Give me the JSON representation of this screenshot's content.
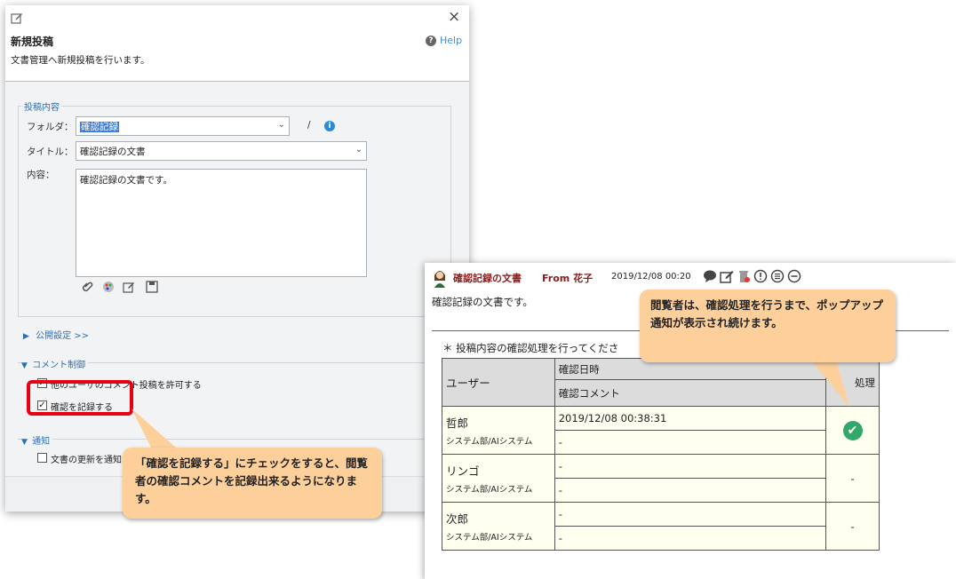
{
  "dialog": {
    "title": "新規投稿",
    "help_label": "Help",
    "description": "文書管理へ新規投稿を行います。",
    "close_glyph": "×",
    "post_section": {
      "legend": "投稿内容",
      "folder_label": "フォルダ：",
      "folder_value": "確認記録",
      "folder_separator": "/",
      "title_label": "タイトル：",
      "title_value": "確認記録の文書",
      "content_label": "内容：",
      "content_value": "確認記録の文書です。",
      "toolbar_icons": [
        "paperclip-icon",
        "palette-icon",
        "edit-icon",
        "save-icon"
      ]
    },
    "publish_section": {
      "label": "公開設定 >>"
    },
    "comment_section": {
      "legend": "コメント制御",
      "allow_comments_label": "他のユーザのコメント投稿を許可する",
      "allow_comments_checked": true,
      "record_confirm_label": "確認を記録する",
      "record_confirm_checked": true
    },
    "notify_section": {
      "legend": "通知",
      "notify_label": "文書の更新を通知す",
      "notify_checked": false
    }
  },
  "callouts": {
    "left_text": "「確認を記録する」にチェックをすると、閲覧者の確認コメントを記録出来るようになります。",
    "right_text": "閲覧者は、確認処理を行うまで、ポップアップ通知が表示され続けます。"
  },
  "panel": {
    "title": "確認記録の文書",
    "from": "From 花子",
    "date": "2019/12/08 00:20",
    "header_icons": [
      "comment-icon",
      "edit-icon",
      "trash-icon",
      "alert-icon",
      "list-icon",
      "minus-icon"
    ],
    "body": "確認記録の文書です。",
    "note": "＊ 投稿内容の確認処理を行ってくださ",
    "table": {
      "col_user": "ユーザー",
      "col_date": "確認日時",
      "col_comment": "確認コメント",
      "col_action": "処理",
      "rows": [
        {
          "name": "哲郎",
          "dept": "システム部/AIシステム",
          "date": "2019/12/08 00:38:31",
          "comment": "-",
          "action": "✔"
        },
        {
          "name": "リンゴ",
          "dept": "システム部/AIシステム",
          "date": "-",
          "comment": "-",
          "action": "-"
        },
        {
          "name": "次郎",
          "dept": "システム部/AIシステム",
          "date": "-",
          "comment": "-",
          "action": "-"
        }
      ]
    }
  },
  "colors": {
    "accent_blue": "#2a6fb4",
    "highlight_red": "#e60012",
    "callout_orange": "#fdcf9b",
    "panel_title": "#8b1a1a",
    "confirm_green": "#33a86b"
  }
}
